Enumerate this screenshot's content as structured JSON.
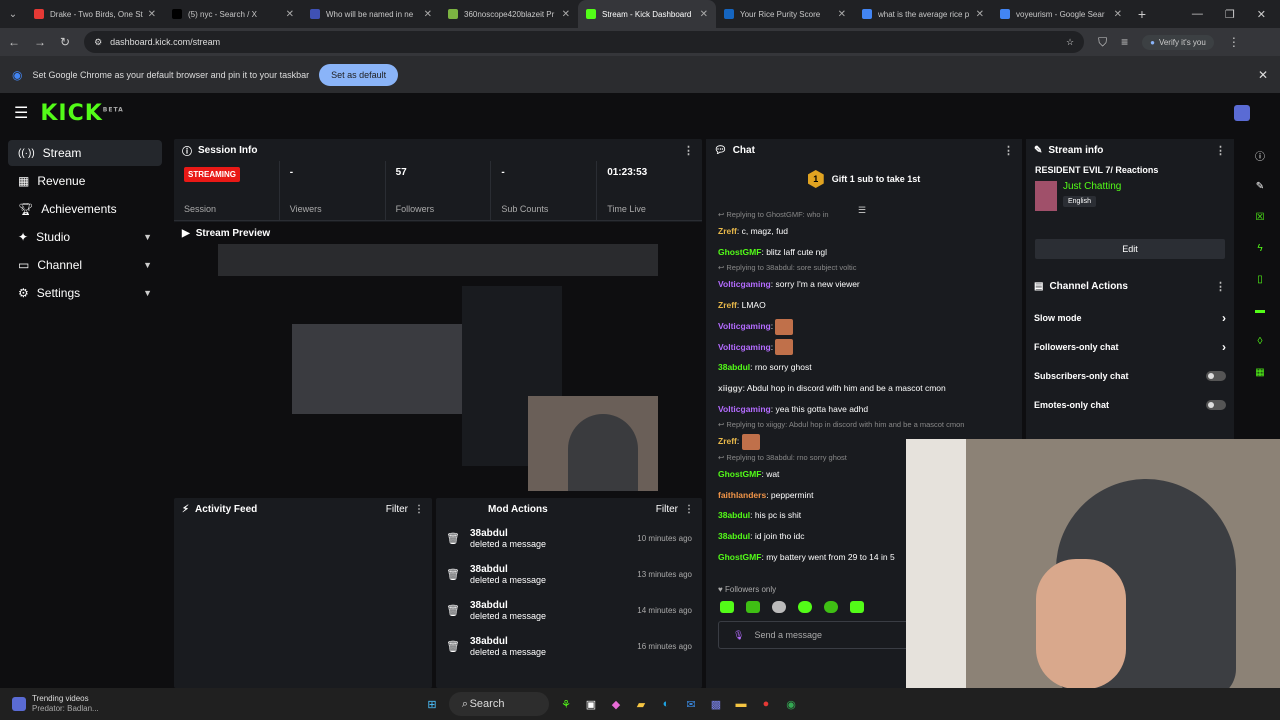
{
  "browser": {
    "tabs": [
      {
        "title": "Drake - Two Birds, One St",
        "color": "#e53935"
      },
      {
        "title": "(5) nyc - Search / X",
        "color": "#000000"
      },
      {
        "title": "Who will be named in ne",
        "color": "#3f51b5"
      },
      {
        "title": "360noscope420blazeit Pr",
        "color": "#7cb342"
      },
      {
        "title": "Stream - Kick Dashboard",
        "color": "#53fc18",
        "active": true
      },
      {
        "title": "Your Rice Purity Score",
        "color": "#1565c0"
      },
      {
        "title": "what is the average rice p",
        "color": "#4285f4"
      },
      {
        "title": "voyeurism - Google Sear",
        "color": "#4285f4"
      }
    ],
    "url": "dashboard.kick.com/stream",
    "verify": "Verify it's you"
  },
  "infobar": {
    "text": "Set Google Chrome as your default browser and pin it to your taskbar",
    "button": "Set as default"
  },
  "logo": {
    "text": "KICK",
    "beta": "BETA"
  },
  "sidebar": {
    "items": [
      {
        "label": "Stream",
        "icon": "stream-icon"
      },
      {
        "label": "Revenue",
        "icon": "revenue-icon"
      },
      {
        "label": "Achievements",
        "icon": "trophy-icon"
      },
      {
        "label": "Studio",
        "icon": "studio-icon"
      },
      {
        "label": "Channel",
        "icon": "channel-icon"
      },
      {
        "label": "Settings",
        "icon": "gear-icon"
      }
    ]
  },
  "session": {
    "title": "Session Info",
    "status": "STREAMING",
    "status_label": "Session",
    "stats": [
      {
        "value": "-",
        "label": "Viewers"
      },
      {
        "value": "57",
        "label": "Followers"
      },
      {
        "value": "-",
        "label": "Sub Counts"
      },
      {
        "value": "01:23:53",
        "label": "Time Live"
      }
    ]
  },
  "preview": {
    "title": "Stream Preview"
  },
  "activity": {
    "title": "Activity Feed",
    "filter": "Filter"
  },
  "mod": {
    "title": "Mod Actions",
    "filter": "Filter",
    "rows": [
      {
        "user": "38abdul",
        "action": "deleted a message",
        "time": "10 minutes ago"
      },
      {
        "user": "38abdul",
        "action": "deleted a message",
        "time": "13 minutes ago"
      },
      {
        "user": "38abdul",
        "action": "deleted a message",
        "time": "14 minutes ago"
      },
      {
        "user": "38abdul",
        "action": "deleted a message",
        "time": "16 minutes ago"
      }
    ]
  },
  "chat": {
    "title": "Chat",
    "gift": "Gift 1 sub to take 1st",
    "gift_rank": "1",
    "followers_only": "Followers only",
    "placeholder": "Send a message",
    "messages": [
      {
        "type": "reply",
        "text": "Replying to GhostGMF: who in"
      },
      {
        "user": "Zreff",
        "cls": "u-y",
        "text": "c, magz, fud"
      },
      {
        "user": "GhostGMF",
        "cls": "u-g",
        "text": "blitz laff cute ngl"
      },
      {
        "type": "reply",
        "text": "Replying to 38abdul: sore subject voltic"
      },
      {
        "user": "Volticgaming",
        "cls": "u-p",
        "text": "sorry I'm a new viewer"
      },
      {
        "user": "Zreff",
        "cls": "u-y",
        "text": "LMAO"
      },
      {
        "user": "Volticgaming",
        "cls": "u-p",
        "text": "",
        "emote": true
      },
      {
        "user": "Volticgaming",
        "cls": "u-p",
        "text": "",
        "emote": true
      },
      {
        "user": "38abdul",
        "cls": "u-g",
        "text": "rno sorry ghost"
      },
      {
        "user": "xiiggy",
        "cls": "u-w",
        "text": "Abdul hop in discord with him and be a mascot cmon"
      },
      {
        "user": "Volticgaming",
        "cls": "u-p",
        "text": "yea this gotta have adhd"
      },
      {
        "type": "reply",
        "text": "Replying to xiiggy: Abdul hop in discord with him and be a mascot cmon"
      },
      {
        "user": "Zreff",
        "cls": "u-y",
        "text": "",
        "emote": true
      },
      {
        "type": "reply",
        "text": "Replying to 38abdul: rno sorry ghost"
      },
      {
        "user": "GhostGMF",
        "cls": "u-g",
        "text": "wat"
      },
      {
        "user": "faithlanders",
        "cls": "u-o",
        "text": "peppermint"
      },
      {
        "user": "38abdul",
        "cls": "u-g",
        "text": "his pc is shit"
      },
      {
        "user": "38abdul",
        "cls": "u-g",
        "text": "id join tho idc"
      },
      {
        "user": "GhostGMF",
        "cls": "u-g",
        "text": "my battery went from 29 to 14 in 5"
      }
    ]
  },
  "streaminfo": {
    "title": "Stream info",
    "stream_title": "RESIDENT EVIL 7/ Reactions",
    "category": "Just Chatting",
    "language": "English",
    "edit": "Edit",
    "actions_title": "Channel Actions",
    "actions": [
      {
        "label": "Slow mode",
        "kind": "chevron"
      },
      {
        "label": "Followers-only chat",
        "kind": "chevron"
      },
      {
        "label": "Subscribers-only chat",
        "kind": "toggle"
      },
      {
        "label": "Emotes-only chat",
        "kind": "toggle"
      }
    ]
  },
  "taskbar": {
    "trend_title": "Trending videos",
    "trend_sub": "Predator: Badlan...",
    "search": "Search"
  },
  "colors": {
    "accent": "#53fc18",
    "live": "#e91916",
    "panel": "#191b1f",
    "bg": "#0e0e10"
  }
}
